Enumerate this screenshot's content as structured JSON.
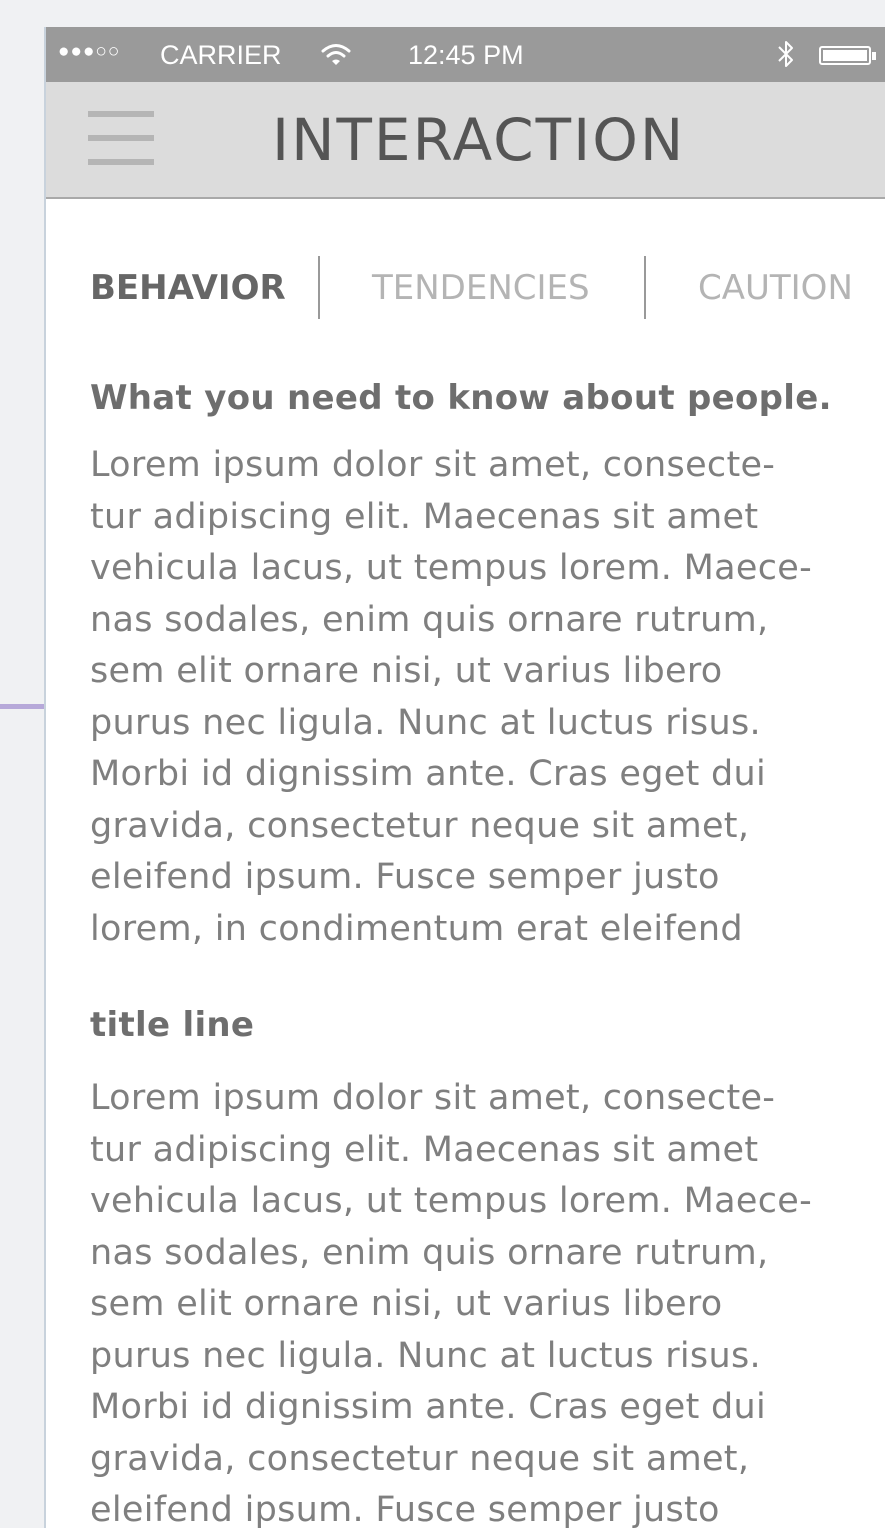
{
  "status_bar": {
    "signal_dots": "●●●○○",
    "carrier": "CARRIER",
    "wifi_icon": "wifi-icon",
    "time": "12:45 PM",
    "bluetooth_icon": "bluetooth-icon",
    "battery_icon": "battery-icon",
    "battery_level": 1.0
  },
  "nav": {
    "menu_icon": "hamburger-menu-icon",
    "title": "INTERACTION"
  },
  "tabs": [
    {
      "label": "BEHAVIOR",
      "active": true
    },
    {
      "label": "TENDENCIES",
      "active": false
    },
    {
      "label": "CAUTION",
      "active": false
    }
  ],
  "sections": [
    {
      "heading": "What you need to know about people.",
      "lines": [
        "Lorem ipsum dolor sit amet, consecte-",
        "tur adipiscing elit. Maecenas sit amet",
        "vehicula lacus, ut tempus lorem. Maece-",
        "nas sodales, enim quis ornare rutrum,",
        "sem elit ornare nisi, ut varius libero",
        "purus nec ligula. Nunc at luctus risus.",
        "Morbi id dignissim ante. Cras eget dui",
        "gravida, consectetur neque sit amet,",
        "eleifend ipsum. Fusce semper justo",
        "lorem, in condimentum erat eleifend"
      ]
    },
    {
      "heading": "title line",
      "lines": [
        "Lorem ipsum dolor sit amet, consecte-",
        "tur adipiscing elit. Maecenas sit amet",
        "vehicula lacus, ut tempus lorem. Maece-",
        "nas sodales, enim quis ornare rutrum,",
        "sem elit ornare nisi, ut varius libero",
        "purus nec ligula. Nunc at luctus risus.",
        "Morbi id dignissim ante. Cras eget dui",
        "gravida, consectetur neque sit amet,",
        "eleifend ipsum. Fusce semper justo"
      ]
    }
  ],
  "colors": {
    "status_bar": "#9a9a9a",
    "nav_bar": "#dcdcdc",
    "title_text": "#555555",
    "active_tab": "#666666",
    "inactive_tab": "#b4b4b4",
    "body_text": "#7f7f7f",
    "accent_line": "#b7a9d9"
  }
}
